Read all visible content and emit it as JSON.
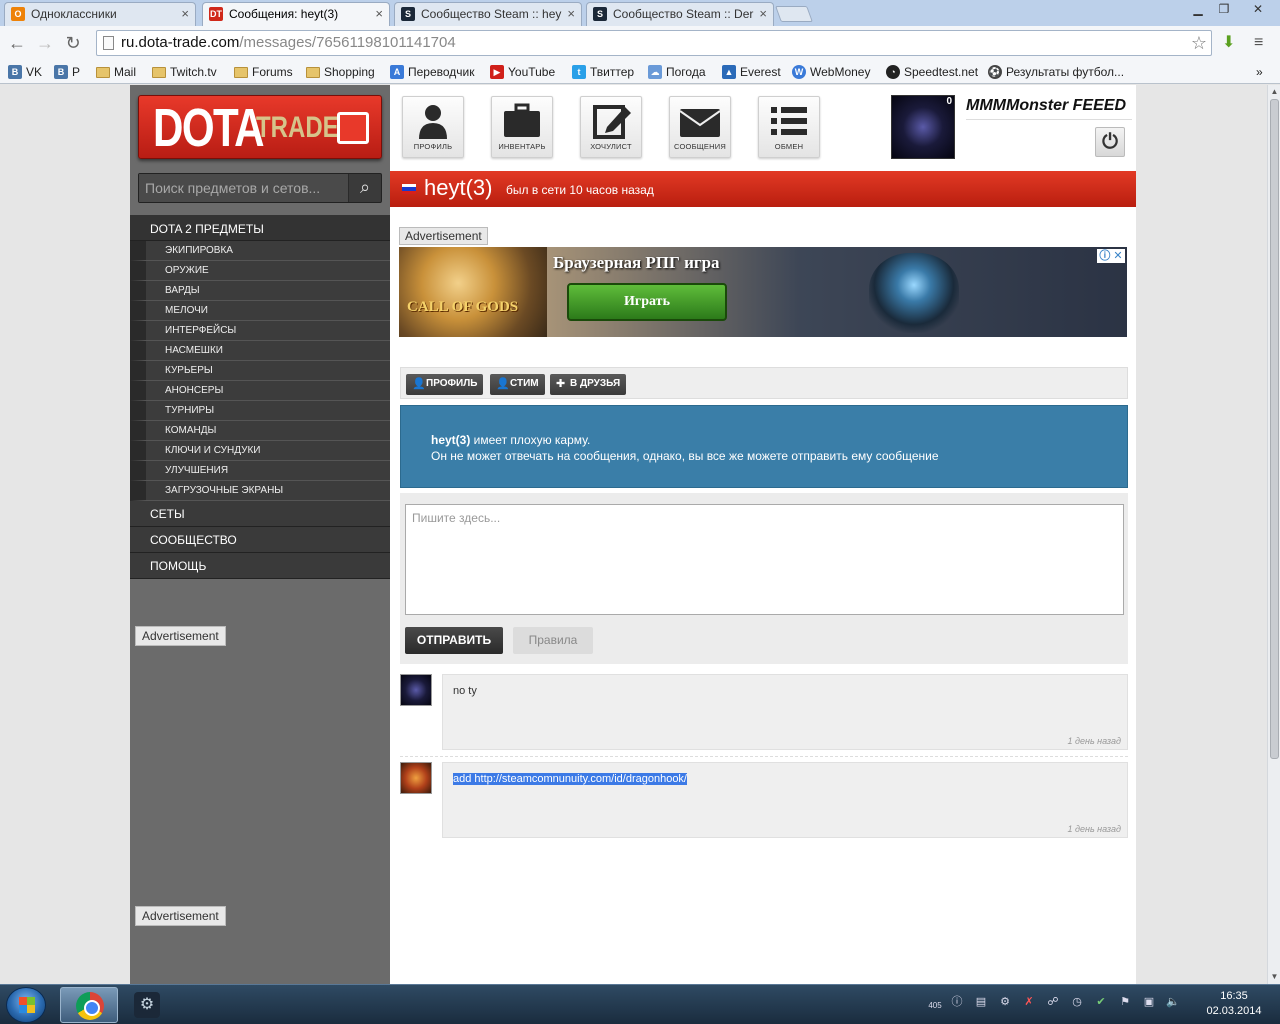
{
  "browser": {
    "tabs": [
      {
        "label": "Одноклассники",
        "icon": "odnoklassniki-icon",
        "color": "#ee8208"
      },
      {
        "label": "Сообщения: heyt(3)",
        "icon": "dotatrade-icon",
        "color": "#d0281a"
      },
      {
        "label": "Сообщество Steam :: hey",
        "icon": "steam-icon",
        "color": "#1b2838"
      },
      {
        "label": "Сообщество Steam :: Der",
        "icon": "steam-icon",
        "color": "#1b2838"
      }
    ],
    "url_host": "ru.dota-trade.com",
    "url_path": "/messages/76561198101141704",
    "bookmarks": [
      {
        "label": "VK",
        "icon": "vk-icon",
        "color": "#4a76a8"
      },
      {
        "label": "P",
        "icon": "vk-icon",
        "color": "#4a76a8"
      },
      {
        "label": "Mail",
        "icon": "folder-icon"
      },
      {
        "label": "Twitch.tv",
        "icon": "folder-icon"
      },
      {
        "label": "Forums",
        "icon": "folder-icon"
      },
      {
        "label": "Shopping",
        "icon": "folder-icon"
      },
      {
        "label": "Переводчик",
        "icon": "translate-icon",
        "color": "#3a7ad8"
      },
      {
        "label": "YouTube",
        "icon": "youtube-icon",
        "color": "#d0201a"
      },
      {
        "label": "Твиттер",
        "icon": "twitter-icon",
        "color": "#2aa0e8"
      },
      {
        "label": "Погода",
        "icon": "weather-icon",
        "color": "#6a9ad8"
      },
      {
        "label": "Everest",
        "icon": "everest-icon",
        "color": "#2a6ab8"
      },
      {
        "label": "WebMoney",
        "icon": "webmoney-icon",
        "color": "#3a7ad8"
      },
      {
        "label": "Speedtest.net",
        "icon": "speedtest-icon",
        "color": "#222"
      },
      {
        "label": "Результаты футбол...",
        "icon": "football-icon",
        "color": "#444"
      }
    ]
  },
  "site": {
    "logo_main": "DOTA",
    "logo_sub": "TRADE",
    "search_placeholder": "Поиск предметов и сетов...",
    "menu_head": "DOTA 2 ПРЕДМЕТЫ",
    "submenu": [
      "ЭКИПИРОВКА",
      "ОРУЖИЕ",
      "ВАРДЫ",
      "МЕЛОЧИ",
      "ИНТЕРФЕЙСЫ",
      "НАСМЕШКИ",
      "КУРЬЕРЫ",
      "АНОНСЕРЫ",
      "ТУРНИРЫ",
      "КОМАНДЫ",
      "КЛЮЧИ И СУНДУКИ",
      "УЛУЧШЕНИЯ",
      "ЗАГРУЗОЧНЫЕ ЭКРАНЫ"
    ],
    "menu_bottom": [
      "СЕТЫ",
      "СООБЩЕСТВО",
      "ПОМОЩЬ"
    ],
    "ad_label": "Advertisement",
    "nav": [
      {
        "label": "ПРОФИЛЬ",
        "icon": "person-icon"
      },
      {
        "label": "ИНВЕНТАРЬ",
        "icon": "briefcase-icon"
      },
      {
        "label": "ХОЧУЛИСТ",
        "icon": "edit-icon"
      },
      {
        "label": "СООБЩЕНИЯ",
        "icon": "envelope-icon"
      },
      {
        "label": "ОБМЕН",
        "icon": "list-icon"
      }
    ],
    "user": {
      "name": "MMMMonster FEEED",
      "badge": "0"
    }
  },
  "profile": {
    "name": "heyt(3)",
    "status": "был в сети 10 часов назад",
    "actions": [
      "ПРОФИЛЬ",
      "СТИМ",
      "В ДРУЗЬЯ"
    ]
  },
  "banner": {
    "logo": "CALL OF GODS",
    "headline": "Браузерная РПГ игра",
    "button": "Играть"
  },
  "karma": {
    "name": "heyt(3)",
    "line1_rest": " имеет плохую карму.",
    "line2": "Он не может отвечать на сообщения, однако, вы все же можете отправить ему сообщение"
  },
  "compose": {
    "placeholder": "Пишите здесь...",
    "send": "ОТПРАВИТЬ",
    "rules": "Правила"
  },
  "messages": [
    {
      "text": "no ty",
      "time": "1 день назад",
      "selected": false
    },
    {
      "text": "add http://steamcomnunuity.com/id/dragonhook/",
      "time": "1 день назад",
      "selected": true
    }
  ],
  "taskbar": {
    "time": "16:35",
    "date": "02.03.2014",
    "tray_count": "405"
  }
}
